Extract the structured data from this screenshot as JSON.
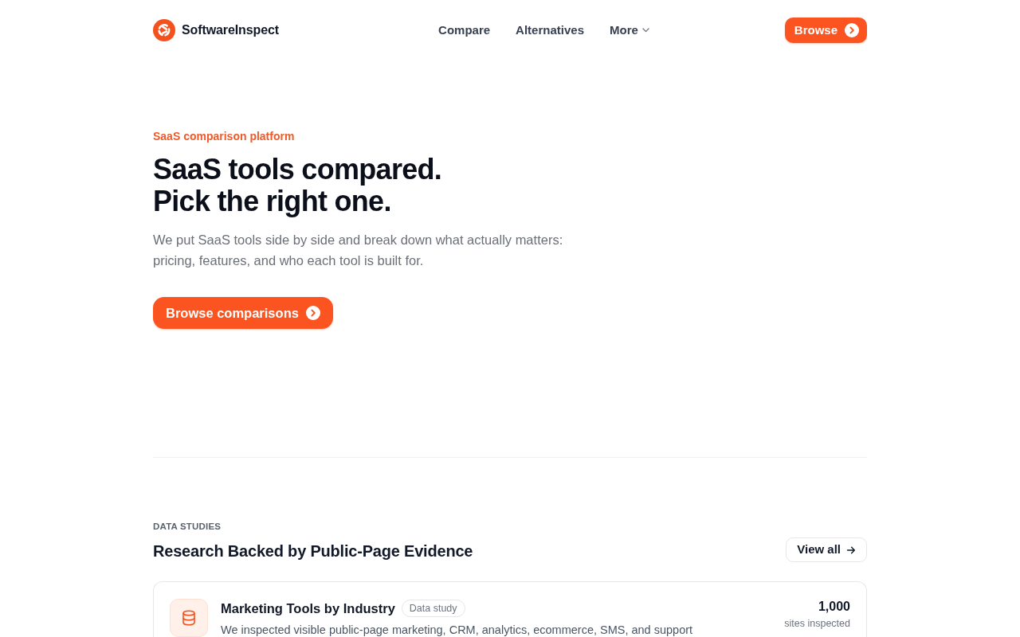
{
  "header": {
    "brand": "SoftwareInspect",
    "nav": [
      {
        "label": "Compare",
        "kind": "link"
      },
      {
        "label": "Alternatives",
        "kind": "link"
      },
      {
        "label": "More",
        "kind": "dropdown"
      }
    ],
    "cta": "Browse"
  },
  "hero": {
    "eyebrow": "SaaS comparison platform",
    "title_lines": [
      "SaaS tools compared.",
      "Pick the right one."
    ],
    "description": "We put SaaS tools side by side and break down what actually matters: pricing, features, and who each tool is built for.",
    "button": "Browse comparisons"
  },
  "studies": {
    "eyebrow": "DATA STUDIES",
    "title": "Research Backed by Public-Page Evidence",
    "view_all": "View all",
    "cards": [
      {
        "title": "Marketing Tools by Industry",
        "badge": "Data study",
        "description": "We inspected visible public-page marketing, CRM, analytics, ecommerce, SMS, and support",
        "stat_value": "1,000",
        "stat_label": "sites inspected"
      }
    ]
  }
}
